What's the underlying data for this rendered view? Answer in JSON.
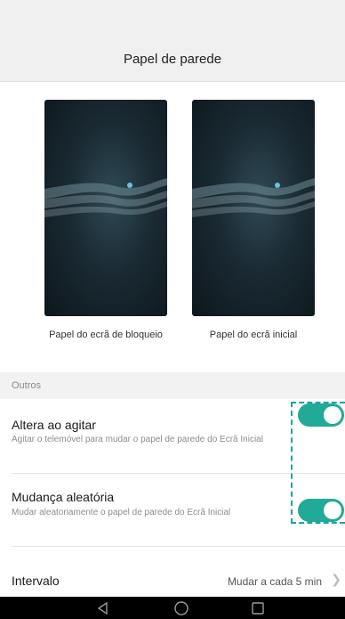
{
  "header": {
    "title": "Papel de parede"
  },
  "wallpapers": [
    {
      "label": "Papel do ecrã de bloqueio"
    },
    {
      "label": "Papel do ecrã inicial"
    }
  ],
  "section": {
    "title": "Outros"
  },
  "settings": {
    "shake": {
      "label": "Altera ao agitar",
      "description": "Agitar o telemóvel para mudar o papel de parede do Ecrã Inicial",
      "enabled": true
    },
    "random": {
      "label": "Mudança aleatória",
      "description": "Mudar aleatoriamente o papel de parede do Ecrã Inicial",
      "enabled": true
    },
    "interval": {
      "label": "Intervalo",
      "value": "Mudar a cada 5 min"
    }
  },
  "colors": {
    "accent": "#22aa98",
    "focus": "#1aa3a0"
  },
  "navbar": {
    "icons": [
      "back-icon",
      "home-icon",
      "recent-apps-icon"
    ]
  }
}
